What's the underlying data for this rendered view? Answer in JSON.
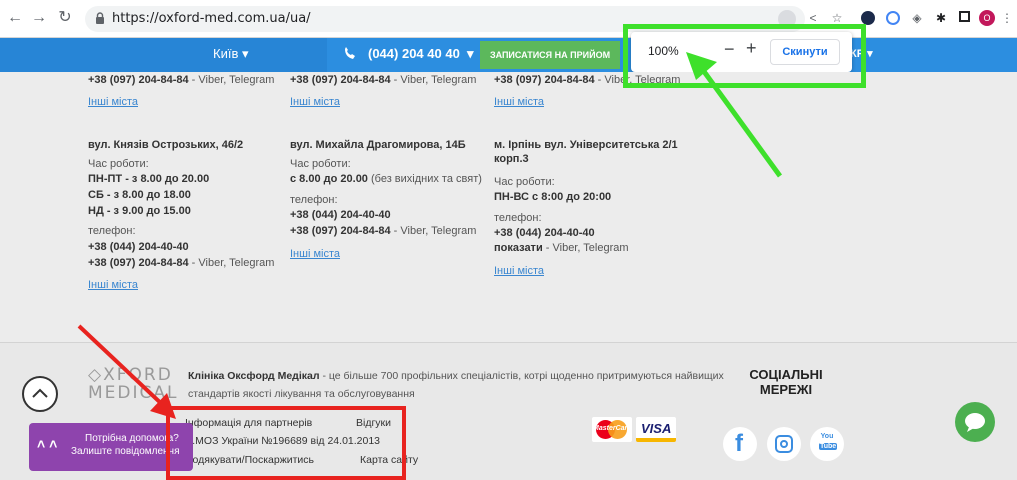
{
  "browser": {
    "url": "https://oxford-med.com.ua/ua/",
    "profile_initial": "O",
    "icons": [
      "back-icon",
      "forward-icon",
      "reload-icon",
      "lock-icon",
      "zoom-icon",
      "share-icon",
      "star-icon",
      "extension-icon",
      "extension-icon",
      "extension-icon",
      "puzzle-icon",
      "sidebar-icon",
      "profile-icon",
      "menu-icon"
    ]
  },
  "header": {
    "city": "Київ",
    "phone": "(044) 204 40 40",
    "appointment_button": "ЗАПИСАТИСЯ НА ПРИЙОМ",
    "lang": "КР"
  },
  "zoom_popup": {
    "zoom_level": "100%",
    "minus": "−",
    "plus": "+",
    "reset": "Скинути"
  },
  "clinics_top_row": [
    {
      "phone_viber": "+38 (097) 204-84-84",
      "viber_note": " - Viber, Telegram",
      "other_cities": "Інші міста"
    },
    {
      "phone_viber": "+38 (097) 204-84-84",
      "viber_note": " - Viber, Telegram",
      "other_cities": "Інші міста"
    },
    {
      "phone_viber": "+38 (097) 204-84-84",
      "viber_note": " - Viber, Telegram",
      "other_cities": "Інші міста"
    }
  ],
  "clinics": [
    {
      "address": "вул. Князів Острозьких, 46/2",
      "hours_label": "Час роботи:",
      "hours": [
        "ПН-ПТ - з 8.00 до 20.00",
        "СБ - з 8.00 до 18.00",
        "НД - з 9.00 до 15.00"
      ],
      "phone_label": "телефон:",
      "phone1": "+38 (044) 204-40-40",
      "phone2": "+38 (097) 204-84-84",
      "phone2_note": " - Viber, Telegram",
      "other_cities": "Інші міста"
    },
    {
      "address": "вул. Михайла Драгомирова, 14Б",
      "hours_label": "Час роботи:",
      "hours_bold": "с 8.00 до 20.00",
      "hours_note": " (без вихідних та свят)",
      "phone_label": "телефон:",
      "phone1": "+38 (044) 204-40-40",
      "phone2": "+38 (097) 204-84-84",
      "phone2_note": " - Viber, Telegram",
      "other_cities": "Інші міста"
    },
    {
      "address_line1": "м. Ірпінь вул. Університетська 2/1",
      "address_line2": "корп.3",
      "hours_label": "Час роботи:",
      "hours": "ПН-ВС с 8:00 до 20:00",
      "phone_label": "телефон:",
      "phone1": "+38 (044) 204-40-40",
      "phone2_bold": "показати",
      "phone2_note": " - Viber, Telegram",
      "other_cities": "Інші міста"
    }
  ],
  "footer": {
    "logo_line1": "◇XFORD",
    "logo_line2": "MEDICAL",
    "about_bold": "Клініка Оксфорд Медікал",
    "about_line1": " - це більше 700 профільних спеціалістів, котрі щоденно притримуються найвищих",
    "about_line2": "стандартів якості лікування та обслуговування",
    "links": {
      "partners": "Інформація для партнерів",
      "reviews": "Відгуки",
      "license": "Ліц.МОЗ України №196689 від 24.01.2013",
      "thanks": "Подякувати/Поскаржитись",
      "sitemap": "Карта сайту"
    },
    "payment": {
      "mastercard": "MasterCard",
      "visa": "VISA"
    },
    "social_title_line1": "СОЦІАЛЬНІ",
    "social_title_line2": "МЕРЕЖІ",
    "social": {
      "facebook": "f",
      "youtube_top": "You",
      "youtube_bottom": "Tube"
    },
    "chat_line1": "Потрібна допомога?",
    "chat_line2": "Залиште повідомлення"
  },
  "colors": {
    "header_blue": "#2c8ee0",
    "appointment_green": "#5cb85c",
    "link_blue": "#3a86d0",
    "annotation_green": "#3ee02b",
    "annotation_red": "#e8231f",
    "chat_purple": "#8e44ad"
  }
}
